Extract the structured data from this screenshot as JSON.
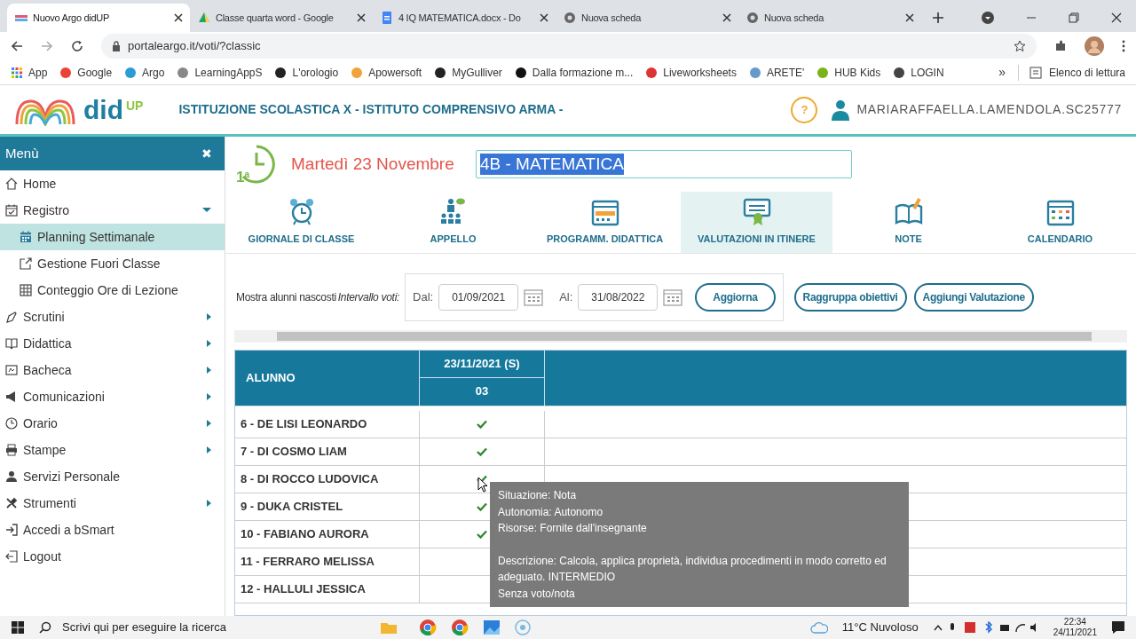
{
  "browser": {
    "tabs": [
      {
        "title": "Nuovo Argo didUP",
        "selected": true
      },
      {
        "title": "Classe quarta word - Google",
        "selected": false
      },
      {
        "title": "4 IQ MATEMATICA.docx - Do",
        "selected": false
      },
      {
        "title": "Nuova scheda",
        "selected": false
      },
      {
        "title": "Nuova scheda",
        "selected": false
      }
    ],
    "address": "portaleargo.it/voti/?classic",
    "bookmarks": [
      "App",
      "Google",
      "Argo",
      "LearningAppS",
      "L'orologio",
      "Apowersoft",
      "MyGulliver",
      "Dalla formazione m...",
      "Liveworksheets",
      "ARETE'",
      "HUB Kids",
      "LOGIN"
    ],
    "more": "»",
    "reading_list": "Elenco di lettura"
  },
  "header": {
    "logo": "did",
    "logo_sup": "UP",
    "school": "ISTITUZIONE SCOLASTICA X - ISTITUTO COMPRENSIVO ARMA -",
    "help": "?",
    "user": "MARIARAFFAELLA.LAMENDOLA.SC25777"
  },
  "sidebar": {
    "title": "Menù",
    "close": "✖",
    "items": [
      {
        "label": "Home",
        "kind": "link",
        "selected": false
      },
      {
        "label": "Registro",
        "kind": "menu",
        "expanded": true,
        "selected": false,
        "children": [
          {
            "label": "Planning Settimanale",
            "selected": true
          },
          {
            "label": "Gestione Fuori Classe",
            "selected": false
          },
          {
            "label": "Conteggio Ore di Lezione",
            "selected": false
          }
        ]
      },
      {
        "label": "Scrutini",
        "kind": "menu",
        "expanded": false,
        "selected": false
      },
      {
        "label": "Didattica",
        "kind": "menu",
        "expanded": false,
        "selected": false
      },
      {
        "label": "Bacheca",
        "kind": "menu",
        "expanded": false,
        "selected": false
      },
      {
        "label": "Comunicazioni",
        "kind": "menu",
        "expanded": false,
        "selected": false
      },
      {
        "label": "Orario",
        "kind": "menu",
        "expanded": false,
        "selected": false
      },
      {
        "label": "Stampe",
        "kind": "menu",
        "expanded": false,
        "selected": false
      },
      {
        "label": "Servizi Personale",
        "kind": "link",
        "selected": false
      },
      {
        "label": "Strumenti",
        "kind": "menu",
        "expanded": false,
        "selected": false
      },
      {
        "label": "Accedi a bSmart",
        "kind": "link",
        "selected": false
      },
      {
        "label": "Logout",
        "kind": "link",
        "selected": false
      }
    ]
  },
  "main": {
    "hour": "1",
    "hour_sup": "a",
    "date": "Martedì 23 Novembre",
    "subject": "4B - MATEMATICA",
    "nav": [
      {
        "label": "GIORNALE DI CLASSE",
        "selected": false
      },
      {
        "label": "APPELLO",
        "selected": false
      },
      {
        "label": "PROGRAMM. DIDATTICA",
        "selected": false
      },
      {
        "label": "VALUTAZIONI IN ITINERE",
        "selected": true
      },
      {
        "label": "NOTE",
        "selected": false
      },
      {
        "label": "CALENDARIO",
        "selected": false
      }
    ],
    "filters": {
      "hidden_students": "Mostra alunni nascosti",
      "range_label": "Intervallo voti:",
      "from_label": "Dal:",
      "from": "01/09/2021",
      "to_label": "Al:",
      "to": "31/08/2022"
    },
    "buttons": [
      "Aggiorna",
      "Raggruppa obiettivi",
      "Aggiungi Valutazione"
    ],
    "table": {
      "columns": [
        "ALUNNO",
        "23/11/2021 (S)",
        "03"
      ],
      "rows": [
        {
          "name": "6 - DE LISI LEONARDO",
          "checked": true
        },
        {
          "name": "7 - DI COSMO LIAM",
          "checked": true
        },
        {
          "name": "8 - DI ROCCO LUDOVICA",
          "checked": true
        },
        {
          "name": "9 - DUKA CRISTEL",
          "checked": true
        },
        {
          "name": "10 - FABIANO AURORA",
          "checked": true
        },
        {
          "name": "11 - FERRARO MELISSA",
          "checked": false
        },
        {
          "name": "12 - HALLULI JESSICA",
          "checked": false
        }
      ]
    },
    "tooltip": {
      "lines": [
        "Situazione: Nota",
        "Autonomia: Autonomo",
        "Risorse: Fornite dall'insegnante"
      ],
      "description": "Descrizione: Calcola, applica proprietà, individua procedimenti in modo corretto ed adeguato. INTERMEDIO",
      "footer": "Senza voto/nota"
    }
  },
  "taskbar": {
    "search_placeholder": "Scrivi qui per eseguire la ricerca",
    "weather": "11°C Nuvoloso",
    "time": "22:34",
    "date": "24/11/2021"
  }
}
